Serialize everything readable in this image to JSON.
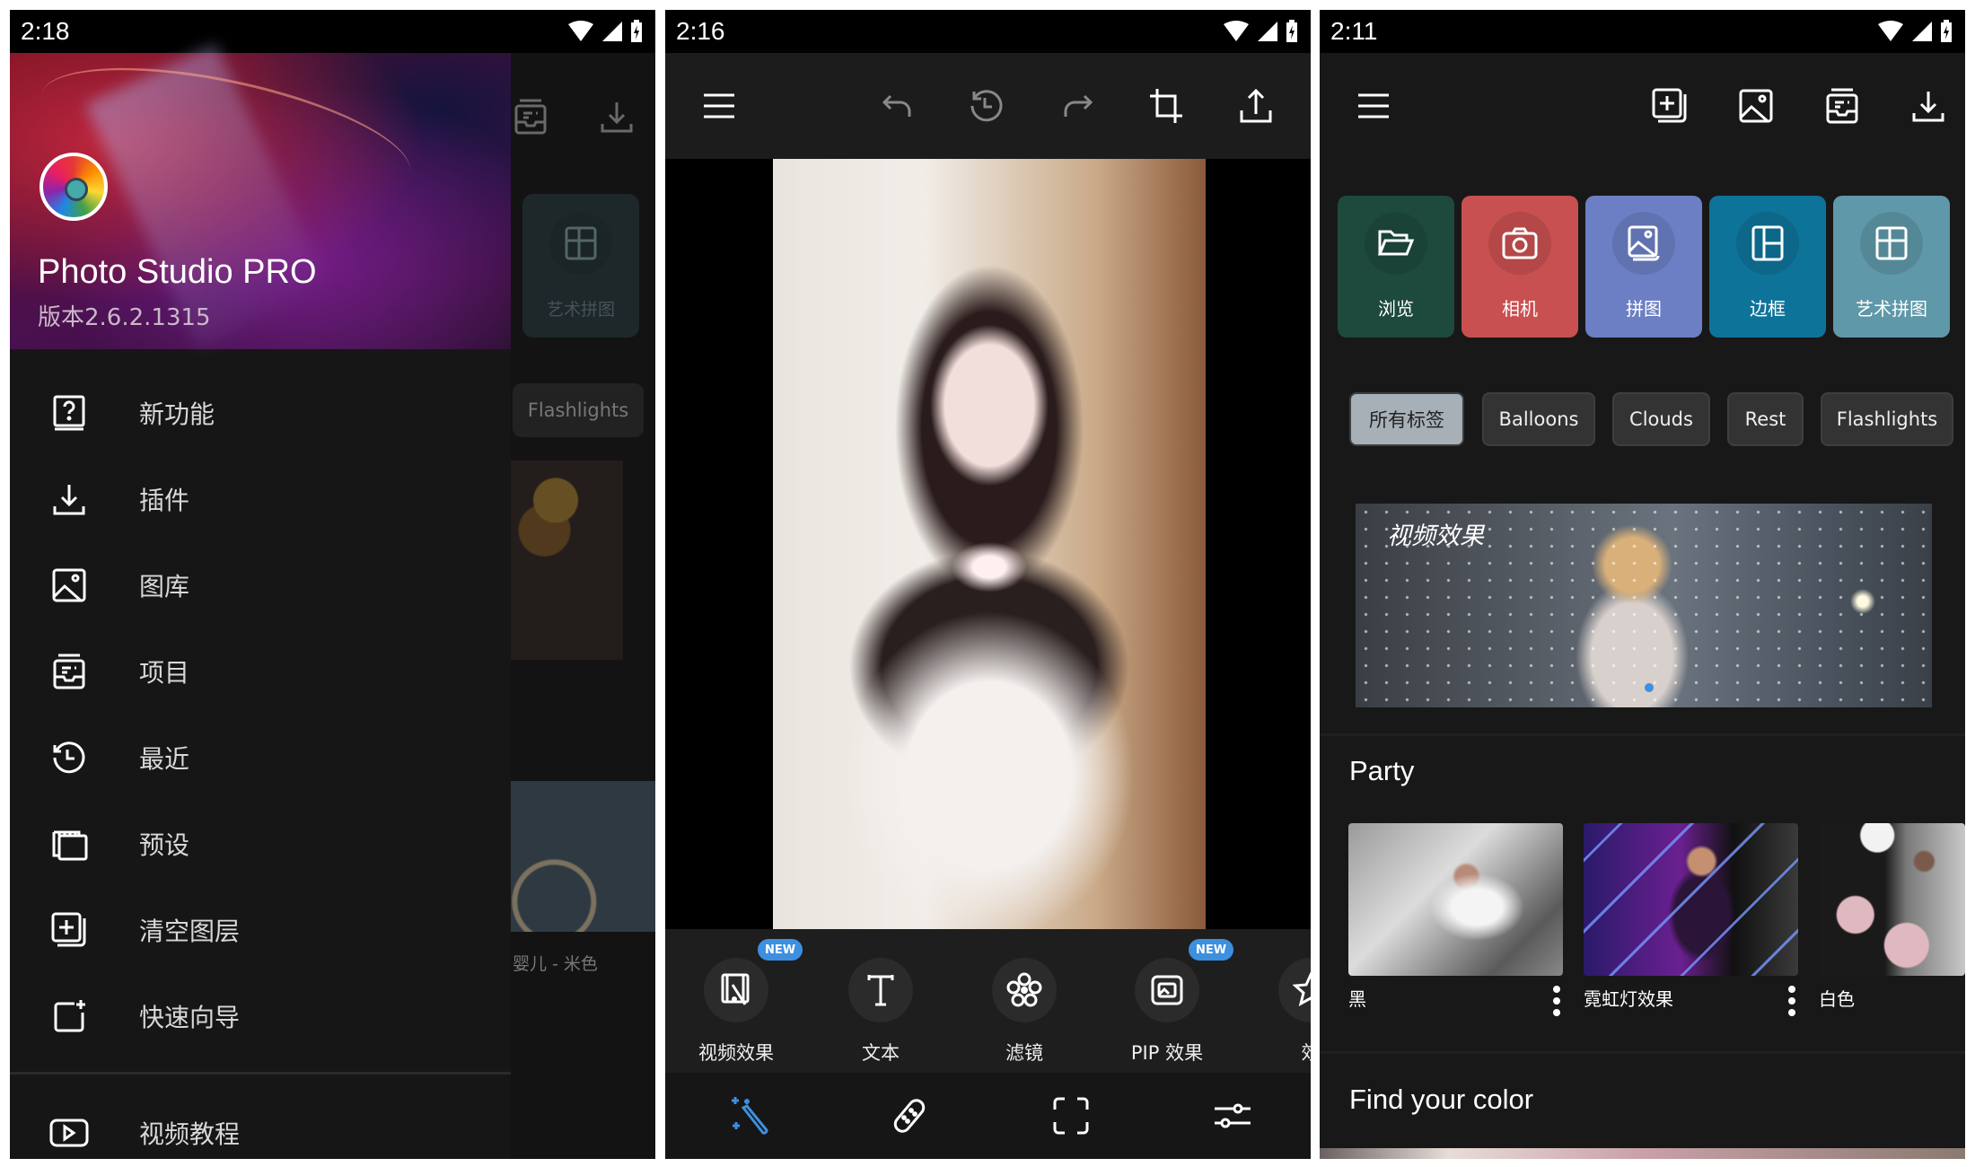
{
  "screens": [
    {
      "status": {
        "time": "2:18"
      },
      "drawer": {
        "app_name": "Photo Studio PRO",
        "version": "版本2.6.2.1315",
        "items": [
          {
            "icon": "whats-new-icon",
            "label": "新功能"
          },
          {
            "icon": "download-icon",
            "label": "插件"
          },
          {
            "icon": "gallery-icon",
            "label": "图库"
          },
          {
            "icon": "projects-icon",
            "label": "项目"
          },
          {
            "icon": "recent-icon",
            "label": "最近"
          },
          {
            "icon": "presets-icon",
            "label": "预设"
          },
          {
            "icon": "add-layer-icon",
            "label": "清空图层"
          },
          {
            "icon": "quick-guide-icon",
            "label": "快速向导"
          }
        ],
        "footer_item": {
          "icon": "video-tutorial-icon",
          "label": "视频教程"
        }
      },
      "background": {
        "tile_label": "艺术拼图",
        "chip_label": "Flashlights",
        "caption": "婴儿 - 米色"
      }
    },
    {
      "status": {
        "time": "2:16"
      },
      "toolbar": {
        "icons": [
          "menu-icon",
          "undo-icon",
          "history-icon",
          "redo-icon",
          "crop-icon",
          "share-icon"
        ]
      },
      "tools": [
        {
          "label": "视频效果",
          "icon": "video-effect-icon",
          "badge": "NEW"
        },
        {
          "label": "文本",
          "icon": "text-icon",
          "badge": ""
        },
        {
          "label": "滤镜",
          "icon": "filter-icon",
          "badge": ""
        },
        {
          "label": "PIP 效果",
          "icon": "pip-icon",
          "badge": "NEW"
        },
        {
          "label": "效",
          "icon": "star-icon",
          "badge": ""
        }
      ],
      "bottom_nav": [
        "magic-wand-icon",
        "bandage-icon",
        "frame-select-icon",
        "adjust-sliders-icon"
      ],
      "accent": "#3d8fe0"
    },
    {
      "status": {
        "time": "2:11"
      },
      "toolbar": {
        "icons": [
          "menu-icon",
          "add-layer-icon",
          "gallery-icon",
          "projects-icon",
          "download-icon"
        ]
      },
      "tiles": [
        {
          "label": "浏览",
          "icon": "folder-icon",
          "color": "#1e4a3e"
        },
        {
          "label": "相机",
          "icon": "camera-icon",
          "color": "#c95050"
        },
        {
          "label": "拼图",
          "icon": "collage-icon",
          "color": "#6c7fc4"
        },
        {
          "label": "边框",
          "icon": "frame-icon",
          "color": "#0e7399"
        },
        {
          "label": "艺术拼图",
          "icon": "art-collage-icon",
          "color": "#5f98a8"
        }
      ],
      "tags": [
        {
          "label": "所有标签",
          "active": true
        },
        {
          "label": "Balloons",
          "active": false
        },
        {
          "label": "Clouds",
          "active": false
        },
        {
          "label": "Rest",
          "active": false
        },
        {
          "label": "Flashlights",
          "active": false
        }
      ],
      "banner": {
        "label": "视频效果"
      },
      "sections": [
        {
          "title": "Party",
          "cards": [
            {
              "caption": "黑"
            },
            {
              "caption": "霓虹灯效果"
            },
            {
              "caption": "白色"
            }
          ]
        },
        {
          "title": "Find your color"
        }
      ]
    }
  ]
}
